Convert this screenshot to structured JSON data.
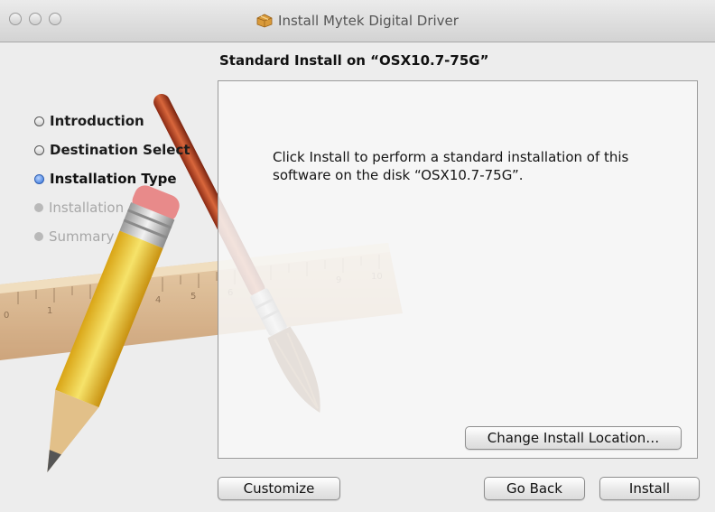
{
  "window": {
    "title": "Install Mytek Digital Driver",
    "title_icon": "package-icon"
  },
  "header": {
    "subtitle": "Standard Install on “OSX10.7-75G”"
  },
  "steps": [
    {
      "label": "Introduction",
      "state": "done"
    },
    {
      "label": "Destination Select",
      "state": "done"
    },
    {
      "label": "Installation Type",
      "state": "current"
    },
    {
      "label": "Installation",
      "state": "pending"
    },
    {
      "label": "Summary",
      "state": "pending"
    }
  ],
  "panel": {
    "message": "Click Install to perform a standard installation of this software on the disk “OSX10.7-75G”.",
    "change_location_label": "Change Install Location…"
  },
  "footer": {
    "customize_label": "Customize",
    "go_back_label": "Go Back",
    "install_label": "Install"
  },
  "art": {
    "ruler_labels": [
      "0",
      "1",
      "4",
      "5",
      "6",
      "9",
      "10"
    ]
  },
  "colors": {
    "current_step": "#2e6fd8",
    "pending_step": "#a7a7a7"
  }
}
